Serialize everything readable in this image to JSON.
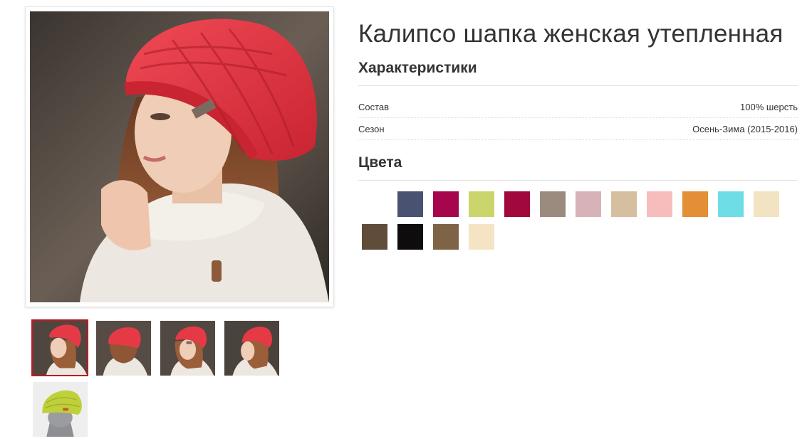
{
  "product": {
    "title": "Калипсо шапка женская утепленная"
  },
  "characteristics": {
    "heading": "Характеристики",
    "rows": [
      {
        "label": "Состав",
        "value": "100% шерсть"
      },
      {
        "label": "Сезон",
        "value": "Осень-Зима (2015-2016)"
      }
    ]
  },
  "colors": {
    "heading": "Цвета",
    "swatches": [
      "#ffffff",
      "#4a5272",
      "#a5064c",
      "#cbd56b",
      "#a0083e",
      "#9b8b7f",
      "#d8b2b9",
      "#d6bea1",
      "#f6bdbc",
      "#e28f35",
      "#6fdde6",
      "#f2e3c2",
      "#5f4c3b",
      "#0e0c0c",
      "#7e6347",
      "#f4e4c4",
      "#ffffff"
    ]
  },
  "gallery": {
    "selected_index": 0,
    "thumbnails": [
      "red-hat-front",
      "red-hat-back",
      "red-hat-side",
      "red-hat-profile",
      "green-hat-mannequin"
    ]
  },
  "theme": {
    "accent": "#c0181f",
    "hat_red": "#e53a45",
    "scarf": "#ece7e0"
  }
}
